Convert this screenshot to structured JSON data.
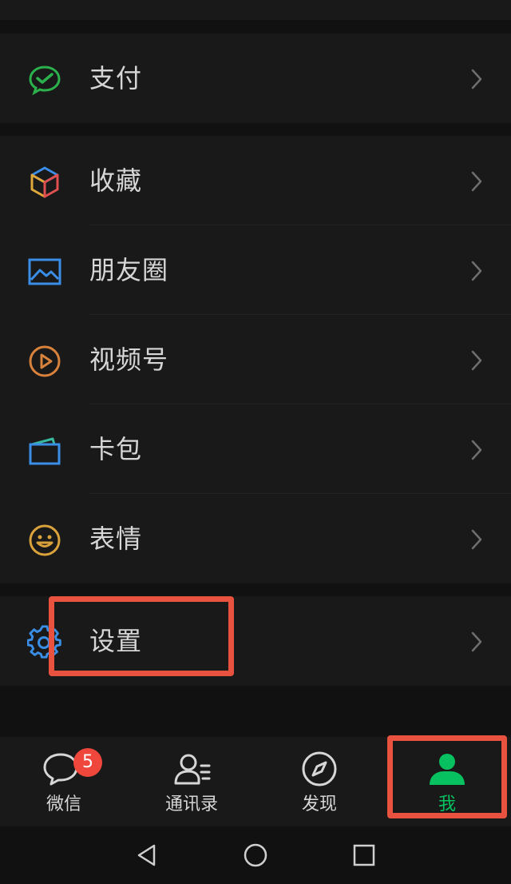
{
  "menu": {
    "pay": {
      "label": "支付",
      "icon": "wechat-pay-icon",
      "color": "#2bb24c"
    },
    "favorites": {
      "label": "收藏",
      "icon": "cube-icon"
    },
    "moments": {
      "label": "朋友圈",
      "icon": "photo-icon",
      "color": "#3a8ee6"
    },
    "channels": {
      "label": "视频号",
      "icon": "play-circle-icon",
      "color": "#d9823b"
    },
    "cards": {
      "label": "卡包",
      "icon": "wallet-icon",
      "color": "#3a8ee6"
    },
    "stickers": {
      "label": "表情",
      "icon": "smiley-icon",
      "color": "#d9a23b"
    },
    "settings": {
      "label": "设置",
      "icon": "gear-icon",
      "color": "#3a8ee6"
    }
  },
  "tabbar": {
    "chats": {
      "label": "微信",
      "badge": "5",
      "icon": "chat-bubble-icon"
    },
    "contacts": {
      "label": "通讯录",
      "icon": "contacts-icon"
    },
    "discover": {
      "label": "发现",
      "icon": "compass-icon"
    },
    "me": {
      "label": "我",
      "icon": "person-icon",
      "active_color": "#07c160"
    }
  },
  "system_nav": {
    "back": "back-triangle-icon",
    "home": "home-circle-icon",
    "recents": "recents-square-icon"
  },
  "colors": {
    "background": "#111111",
    "surface": "#191919",
    "text": "#d6d6d6",
    "annotation_red": "#e8523f",
    "badge_red": "#f0473c"
  }
}
